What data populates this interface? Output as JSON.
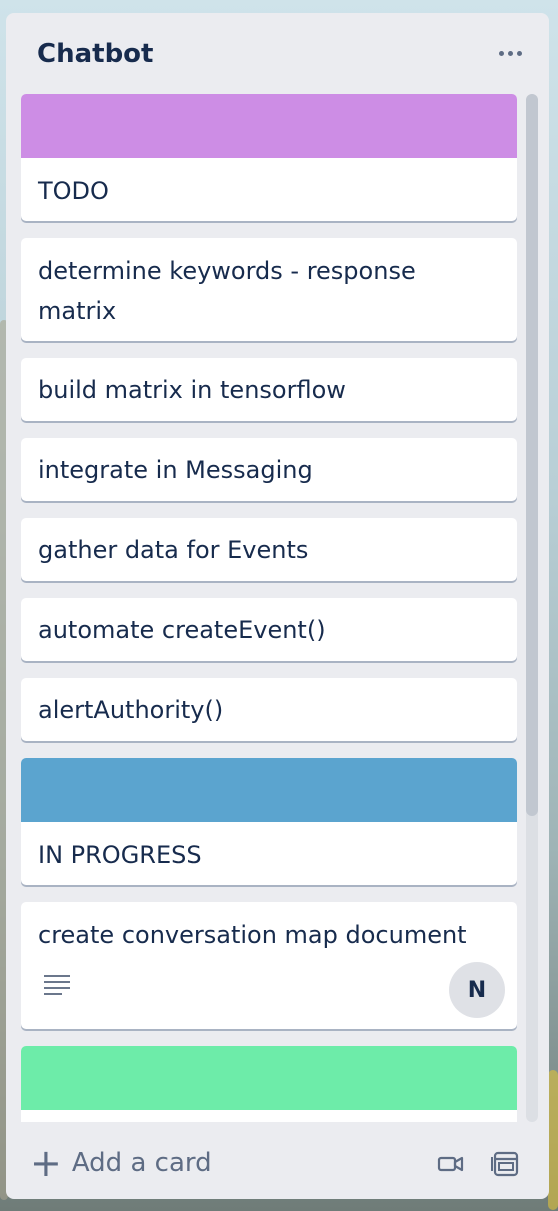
{
  "list": {
    "title": "Chatbot",
    "more_icon": "ellipsis-icon"
  },
  "cards": [
    {
      "cover_color": "#cd8de5",
      "text": "TODO"
    },
    {
      "text": "determine keywords - response matrix"
    },
    {
      "text": "build matrix in tensorflow"
    },
    {
      "text": "integrate in Messaging"
    },
    {
      "text": "gather data for Events"
    },
    {
      "text": "automate createEvent()"
    },
    {
      "text": "alertAuthority()"
    },
    {
      "cover_color": "#5ba4cf",
      "text": "IN PROGRESS"
    },
    {
      "text": "create conversation map document",
      "has_description_icon": true,
      "member_initial": "N"
    },
    {
      "cover_color": "#6deca9",
      "text": ""
    }
  ],
  "footer": {
    "add_card_label": "Add a card",
    "plus_icon": "plus-icon",
    "icons": [
      "video-icon",
      "card-template-icon"
    ]
  }
}
